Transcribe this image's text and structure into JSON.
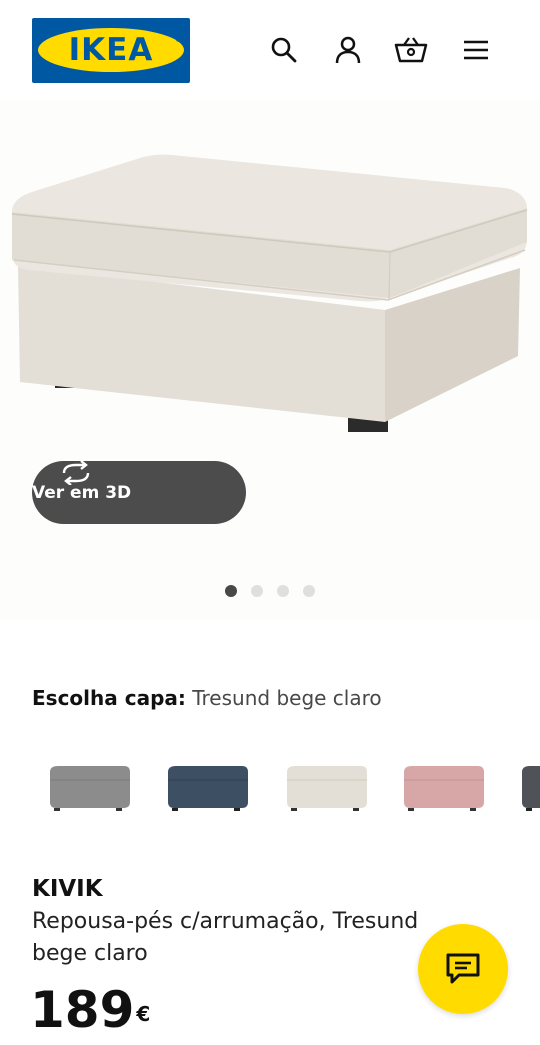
{
  "header": {
    "logo_text": "IKEA",
    "logo_reg": "®",
    "icons": [
      "search-icon",
      "user-icon",
      "cart-icon",
      "menu-icon"
    ]
  },
  "hero": {
    "view3d_label": "Ver em 3D",
    "carousel_count": 4,
    "carousel_active": 1
  },
  "cover": {
    "label": "Escolha capa:",
    "value": "Tresund bege claro",
    "swatches": [
      {
        "name": "grey",
        "color": "#8c8c8c"
      },
      {
        "name": "dark-blue",
        "color": "#3d4f62"
      },
      {
        "name": "light-beige",
        "color": "#e4dfd6"
      },
      {
        "name": "pink",
        "color": "#d7a7a8"
      },
      {
        "name": "dark-grey",
        "color": "#4f5256"
      }
    ]
  },
  "product": {
    "name": "KIVIK",
    "description": "Repousa-pés c/arrumação, Tresund bege claro",
    "price": "189",
    "currency": "€"
  },
  "colors": {
    "brand_blue": "#0058a3",
    "brand_yellow": "#ffdb00",
    "button_dark": "#4c4c4c"
  }
}
